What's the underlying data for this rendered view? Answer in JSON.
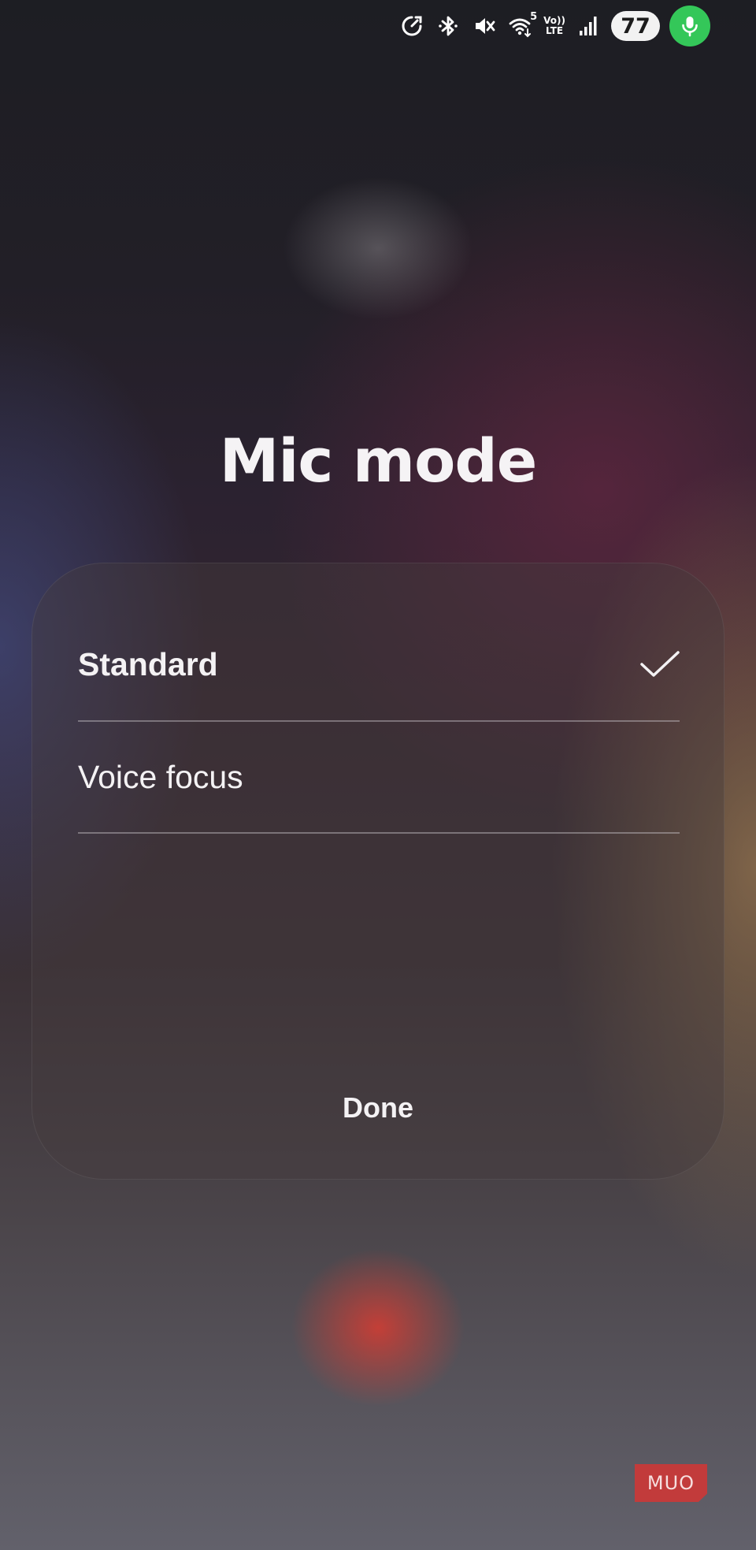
{
  "status_bar": {
    "icons": [
      "data-saver-icon",
      "bluetooth-icon",
      "vibrate-mute-icon",
      "wifi-5g-icon",
      "volte-icon",
      "signal-icon",
      "battery-icon",
      "mic-active-icon"
    ],
    "wifi_label": "5",
    "volte_top": "Vo))",
    "volte_bottom": "LTE",
    "battery_level": "77",
    "mic_active_color": "#34c759"
  },
  "dialog": {
    "title": "Mic mode",
    "options": [
      {
        "label": "Standard",
        "selected": true
      },
      {
        "label": "Voice focus",
        "selected": false
      }
    ],
    "done_label": "Done"
  },
  "watermark": {
    "text": "MUO",
    "color": "#c23b3b"
  }
}
